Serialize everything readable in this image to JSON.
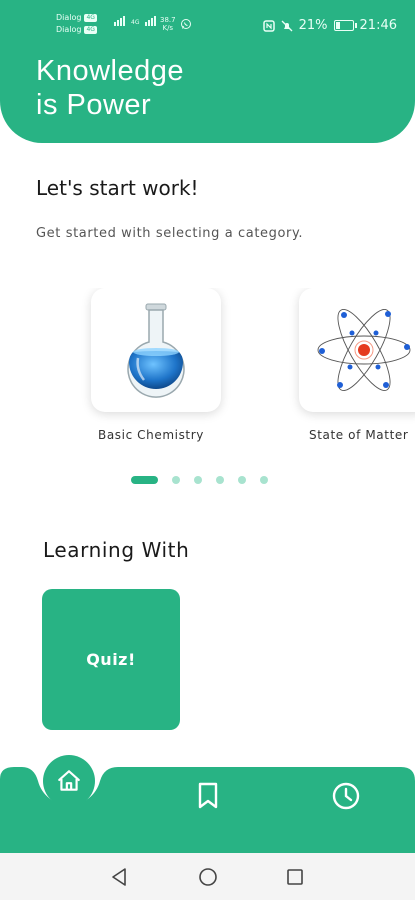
{
  "status_bar": {
    "carrier_1": "Dialog",
    "carrier_1_tag": "4G",
    "carrier_2": "Dialog",
    "carrier_2_tag": "4G",
    "network_type": "4G",
    "data_speed": "38.7",
    "data_speed_unit": "K/s",
    "battery": "21%",
    "time": "21:46"
  },
  "header": {
    "title_line_1": "Knowledge",
    "title_line_2": "is Power",
    "background_color": "#28b384"
  },
  "intro": {
    "greeting": "Let's start work!",
    "subtitle": "Get started with selecting a category."
  },
  "categories": [
    {
      "label": "Basic Chemistry",
      "icon": "round-flask-icon"
    },
    {
      "label": "State of Matter",
      "icon": "atom-icon"
    }
  ],
  "pagination": {
    "total": 6,
    "active_index": 0
  },
  "learning": {
    "section_title": "Learning With",
    "quiz_label": "Quiz!"
  },
  "bottom_nav": {
    "items": [
      {
        "icon": "home-icon",
        "active": true
      },
      {
        "icon": "bookmark-icon",
        "active": false
      },
      {
        "icon": "clock-icon",
        "active": false
      }
    ]
  },
  "system_nav": {
    "items": [
      "back-icon",
      "home-circle-icon",
      "recents-icon"
    ]
  },
  "colors": {
    "accent": "#28b384",
    "accent_light": "#a8e3cf"
  }
}
